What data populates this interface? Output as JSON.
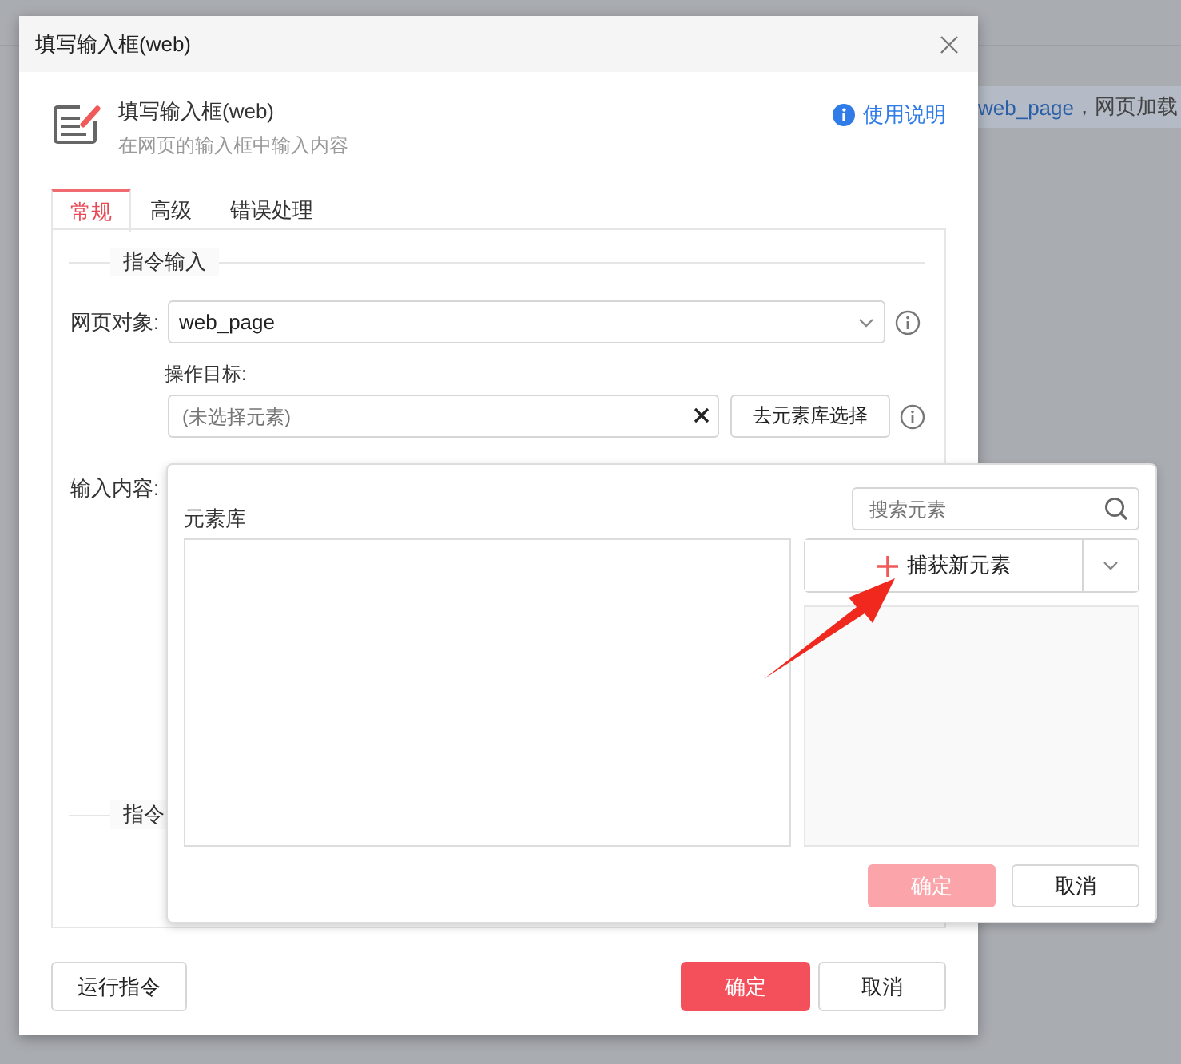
{
  "background": {
    "link": "web_page",
    "text": "，网页加载"
  },
  "dialog": {
    "title": "填写输入框(web)",
    "header": {
      "title": "填写输入框(web)",
      "subtitle": "在网页的输入框中输入内容",
      "help": "使用说明"
    },
    "tabs": [
      {
        "label": "常规",
        "selected": true
      },
      {
        "label": "高级",
        "selected": false
      },
      {
        "label": "错误处理",
        "selected": false
      }
    ],
    "section_title": "指令输入",
    "web_object": {
      "label": "网页对象:",
      "value": "web_page"
    },
    "target": {
      "label": "操作目标:",
      "placeholder": "(未选择元素)",
      "button": "去元素库选择"
    },
    "input_content": {
      "label": "输入内容:"
    },
    "section_2_title": "指令",
    "buttons": {
      "run": "运行指令",
      "ok": "确定",
      "cancel": "取消"
    }
  },
  "element_library": {
    "title": "元素库",
    "search": {
      "placeholder": "搜索元素"
    },
    "capture": "捕获新元素",
    "ok": {
      "label": "确定",
      "disabled": true
    },
    "cancel": "取消"
  }
}
